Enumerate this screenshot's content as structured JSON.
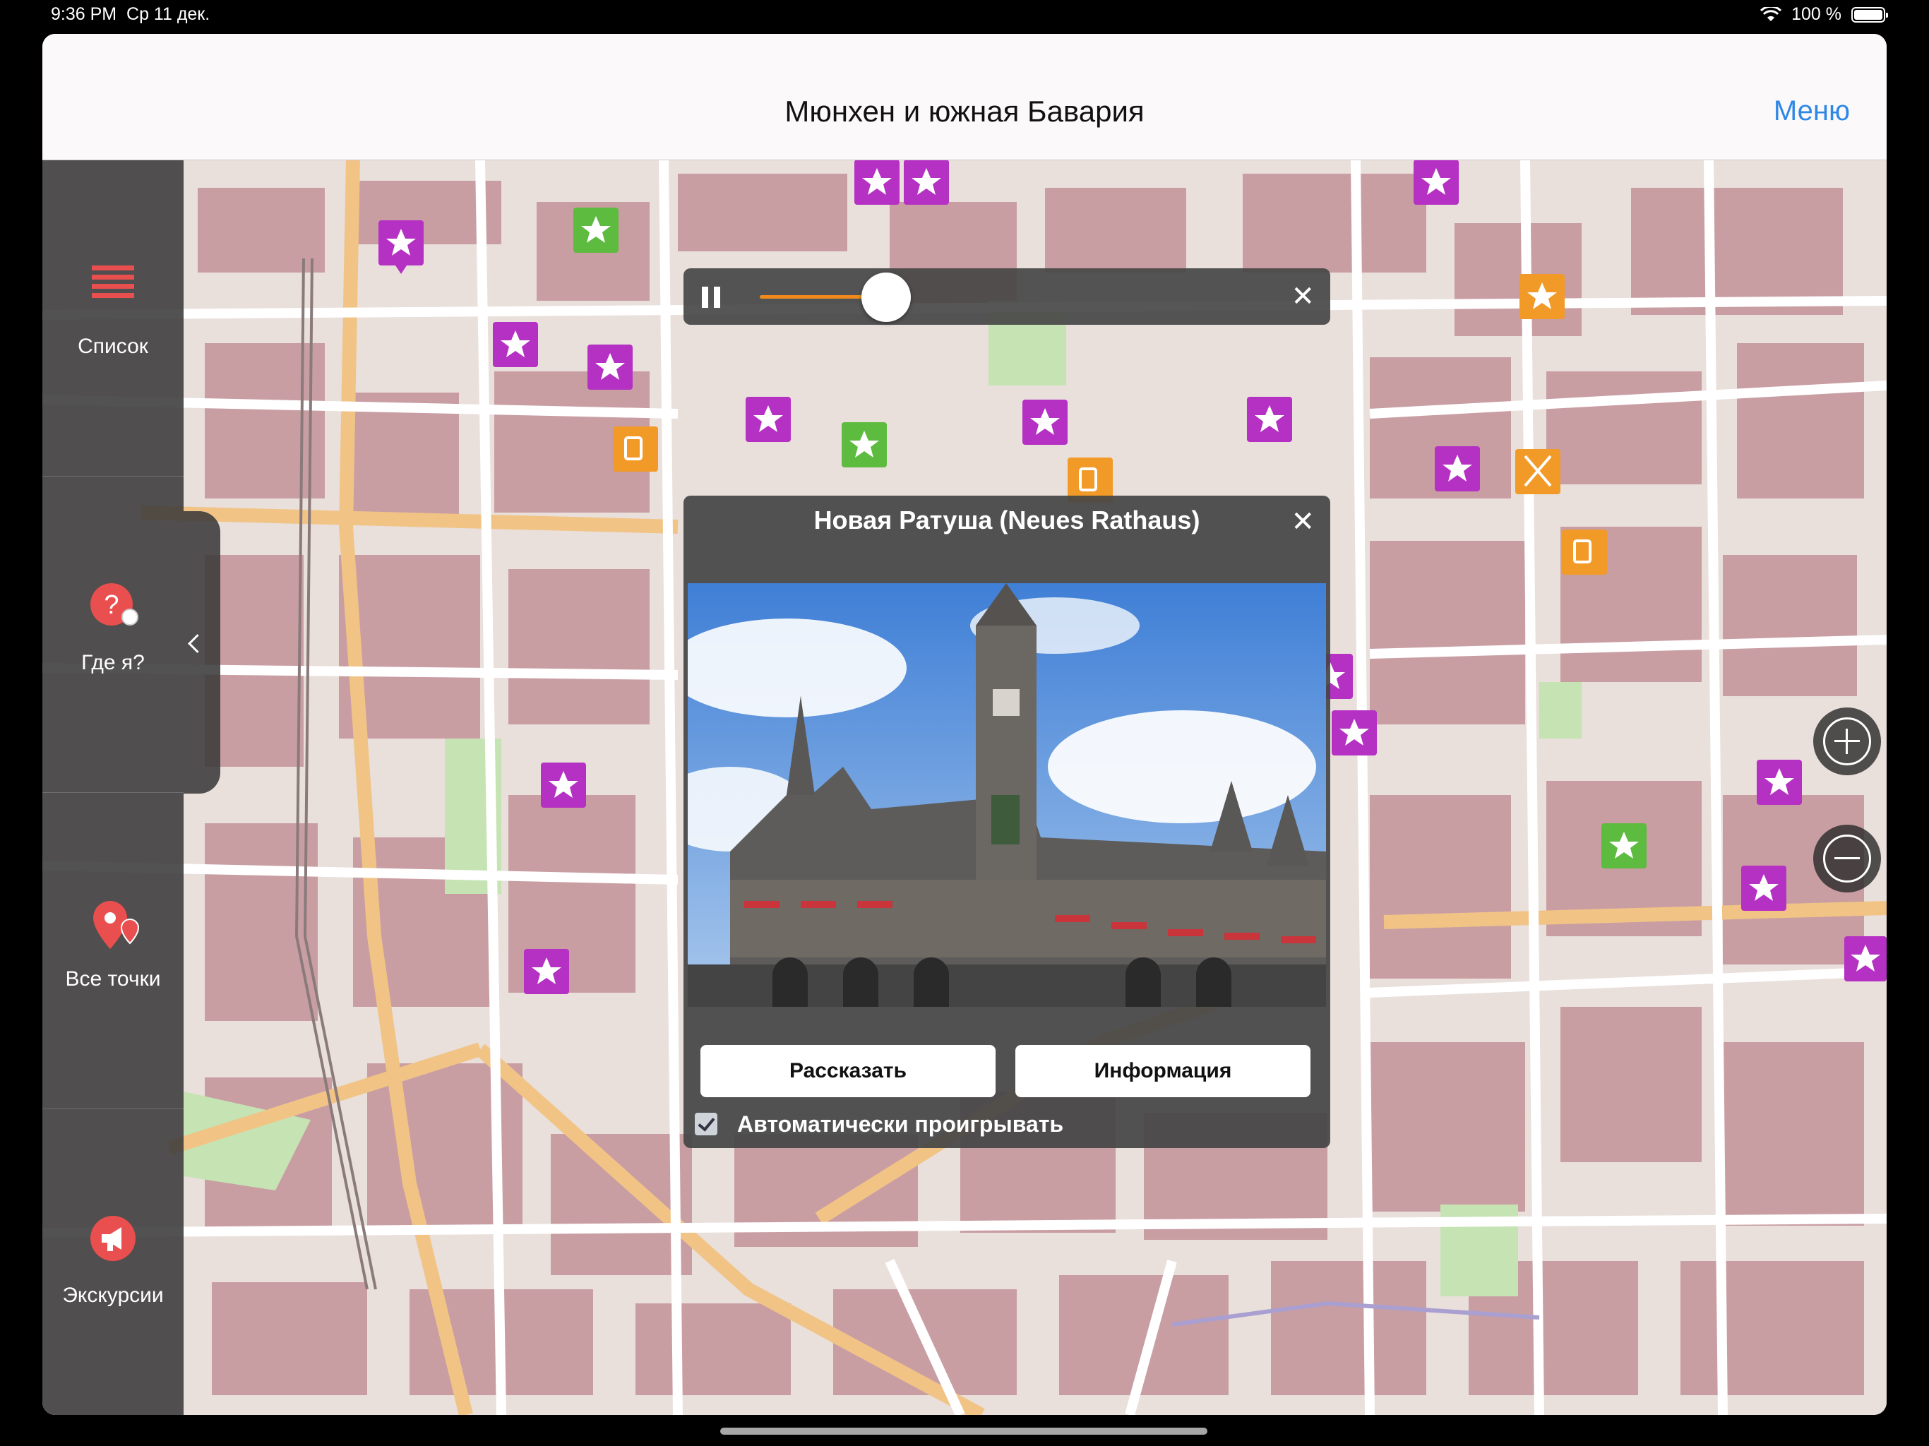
{
  "status_bar": {
    "time": "9:36 PM",
    "date": "Ср 11 дек.",
    "battery": "100 %",
    "icons": [
      "wifi-icon",
      "battery-icon"
    ]
  },
  "navbar": {
    "title": "Мюнхен и южная Бавария",
    "menu_label": "Меню"
  },
  "sidebar": {
    "items": [
      {
        "label": "Список",
        "icon": "list-icon"
      },
      {
        "label": "Где я?",
        "icon": "where-am-i-icon"
      },
      {
        "label": "Все точки",
        "icon": "all-points-icon"
      },
      {
        "label": "Экскурсии",
        "icon": "tours-icon"
      }
    ],
    "collapse_icon": "chevron-left-icon"
  },
  "map": {
    "zoom_in_icon": "zoom-in-icon",
    "zoom_out_icon": "zoom-out-icon"
  },
  "player": {
    "progress": 0.22,
    "accent": "#f08a1c",
    "close_icon": "close-icon"
  },
  "popup": {
    "title": "Новая Ратуша (Neues Rathaus)",
    "tell_label": "Рассказать",
    "info_label": "Информация",
    "autoplay_label": "Автоматически проигрывать",
    "autoplay_checked": true
  },
  "marker_colors": {
    "sight": "#b531c3",
    "park": "#5dbb3f",
    "food": "#f19a28"
  }
}
